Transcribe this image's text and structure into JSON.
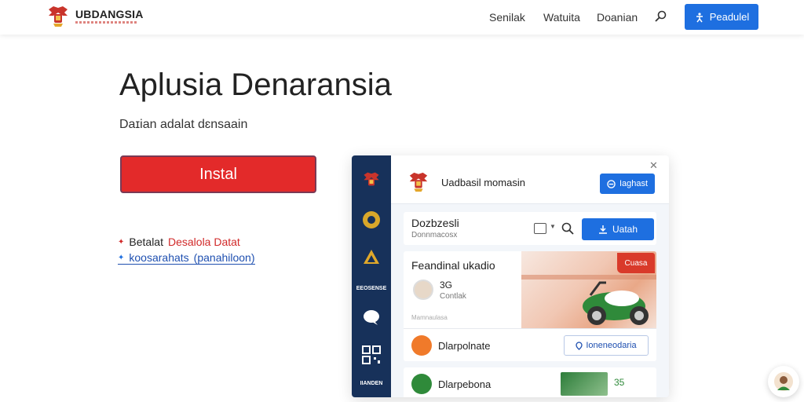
{
  "nav": {
    "brand": "UBDANGSIA",
    "links": [
      "Senilak",
      "Watuita",
      "Doanian"
    ],
    "cta_label": "Peadulel"
  },
  "hero": {
    "title": "Aplusia Denaransia",
    "subtitle": "Daɪian adalat dɛnsaain",
    "install_label": "Instal",
    "features": [
      {
        "text1": "Betalat",
        "text2": "Desalola Datat"
      },
      {
        "text1": "koosarahats",
        "text2": "(panahiloon)"
      }
    ]
  },
  "mock": {
    "sidebar_labels": [
      "EEOSENSE",
      "IIANDEN"
    ],
    "header_title": "Uadbasil momasin",
    "header_button": "Iaghast",
    "top_card": {
      "title": "Dozbzesli",
      "subtitle": "Donnmacosx",
      "button": "Uatah"
    },
    "main_card": {
      "title": "Feandinal ukadio",
      "tag": "Cuasa",
      "number": "3G",
      "number_sub": "Contlak",
      "tiny": "Mamnaulasa",
      "row_text": "Dlarpolnate",
      "row_button": "Ioneneodaria"
    },
    "bottom_card": {
      "text": "Dlarpebona",
      "number": "35"
    }
  },
  "colors": {
    "primary": "#1e6fe0",
    "install": "#e32a2a",
    "sidebar": "#17315a"
  }
}
